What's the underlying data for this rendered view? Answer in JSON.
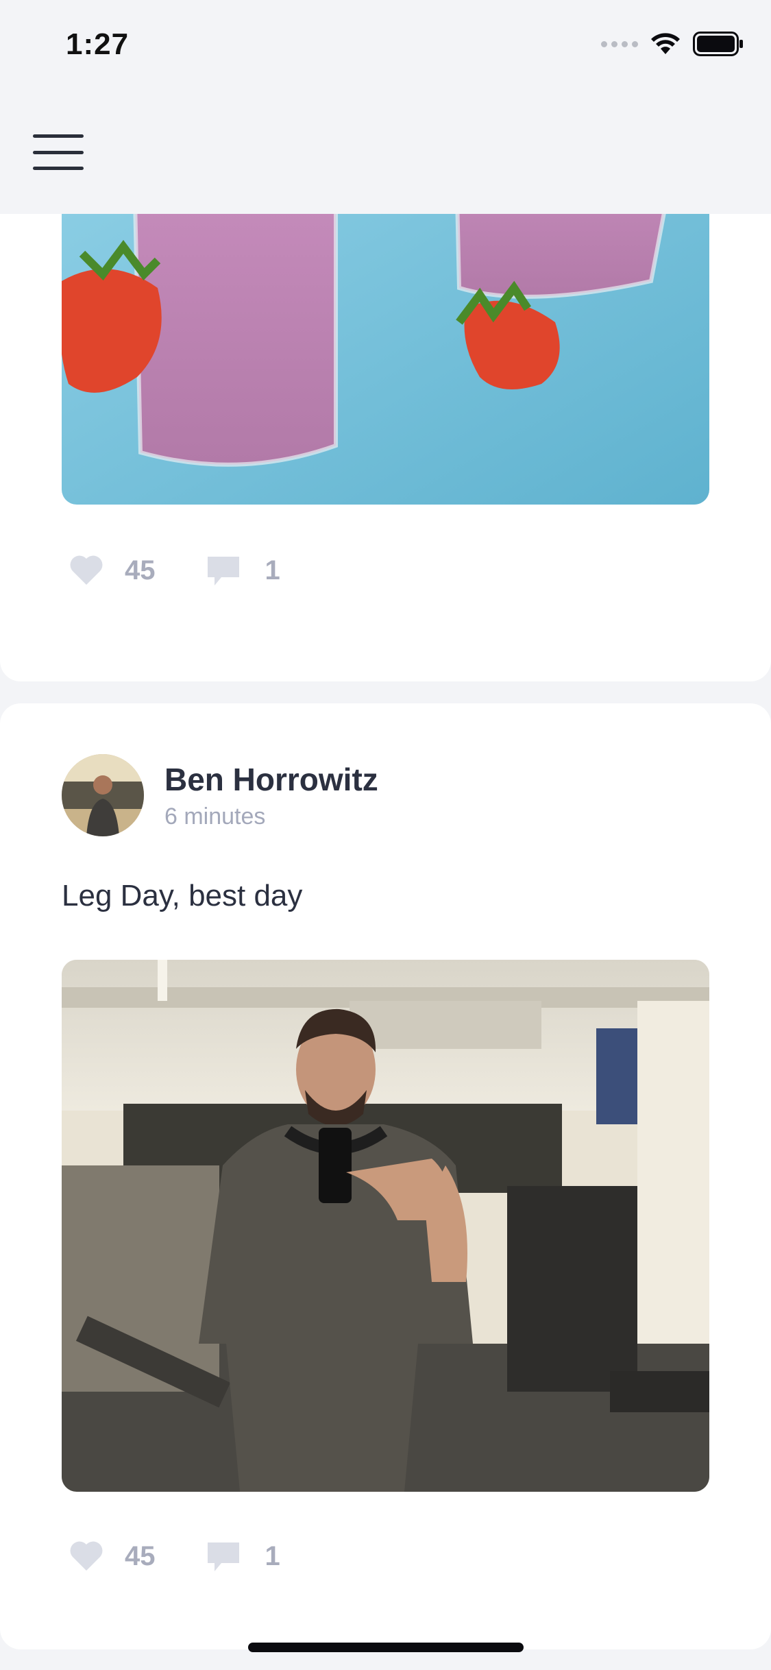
{
  "status_bar": {
    "time": "1:27"
  },
  "header": {
    "menu_icon": "hamburger-menu-icon"
  },
  "posts": [
    {
      "image_description_icon": "smoothie-photo",
      "likes": "45",
      "comments": "1"
    },
    {
      "author": "Ben Horrowitz",
      "time": "6 minutes",
      "text": "Leg Day, best day",
      "image_description_icon": "gym-selfie-photo",
      "likes": "45",
      "comments": "1"
    }
  ],
  "colors": {
    "background": "#f3f4f7",
    "card": "#ffffff",
    "muted": "#a8acbc",
    "title": "#2b3040"
  }
}
